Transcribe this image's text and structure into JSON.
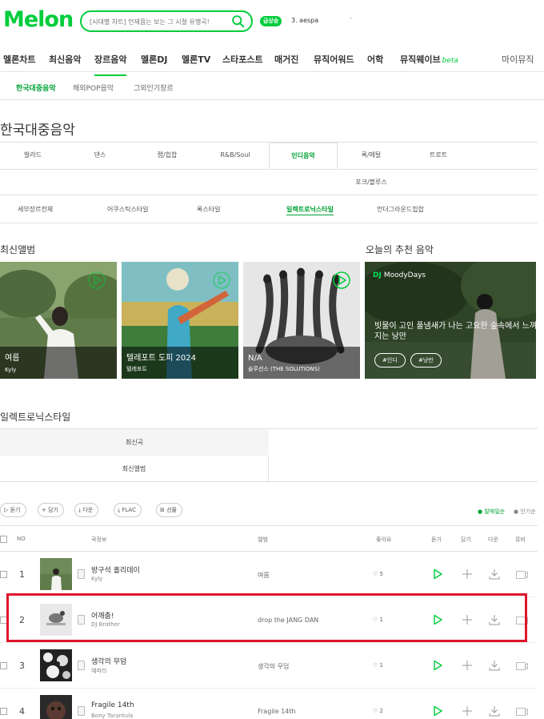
{
  "header": {
    "logo": "Melon",
    "search_placeholder": "[시대별 차트] 언제쯤는 보는 그 시절 유행곡!",
    "rank_badge": "급상승",
    "rank_text": "3.  aespa",
    "rank_dash": "-"
  },
  "gnb": {
    "items": [
      "멜론차트",
      "최신음악",
      "장르음악",
      "멜론DJ",
      "멜론TV",
      "스타포스트",
      "매거진",
      "뮤직어워드",
      "어학",
      "뮤직웨이브"
    ],
    "beta": "beta",
    "mymusic": "마이뮤직"
  },
  "lnb": {
    "items": [
      "한국대중음악",
      "해외POP음악",
      "그외인기장르"
    ]
  },
  "page_title": "한국대중음악",
  "genres": {
    "row1": [
      "발라드",
      "댄스",
      "랩/힙합",
      "R&B/Soul",
      "인디음악",
      "록/메탈",
      "트로트"
    ],
    "row2": [
      "포크/블루스"
    ]
  },
  "subgenres": [
    "세부장르전체",
    "어쿠스틱스타일",
    "록스타일",
    "일렉트로닉스타일",
    "언더그라운드힙합"
  ],
  "latest": {
    "title": "최신앨범",
    "albums": [
      {
        "title": "여름",
        "artist": "Kyly"
      },
      {
        "title": "텔레포트 도피 2024",
        "artist": "텔레포트"
      },
      {
        "title": "N/A",
        "artist": "솔루션스 (THE SOLUTIONS)"
      }
    ]
  },
  "recommend": {
    "title": "오늘의 추천 음악",
    "dj_label": "DJ",
    "dj_name": "MoodyDays",
    "dj_title": "빗물이 고인 풀냄새가 나는 고요한 숲속에서 느껴지는 낭만",
    "tags": [
      "#인디",
      "#낭만"
    ]
  },
  "electronic": {
    "title": "일렉트로닉스타일",
    "tab_songs": "최신곡",
    "tab_albums": "최신앨범"
  },
  "toolbar": {
    "buttons": [
      "듣기",
      "담기",
      "다운",
      "FLAC",
      "선물"
    ],
    "sort_on": "● 발매일순",
    "sort_off": "● 인기순"
  },
  "table": {
    "headers": {
      "no": "NO",
      "song": "곡정보",
      "album": "앨범",
      "like": "좋아요",
      "listen": "듣기",
      "add": "담기",
      "down": "다운",
      "mv": "뮤비"
    },
    "rows": [
      {
        "no": "1",
        "title": "방구석 홀리데이",
        "artist": "Kyly",
        "album": "여름",
        "likes": "5"
      },
      {
        "no": "2",
        "title": "어깨춤!",
        "artist": "DJ Brother",
        "album": "drop the JANG DAN",
        "likes": "1"
      },
      {
        "no": "3",
        "title": "생각의 무덤",
        "artist": "혜파리",
        "album": "생각의 무덤",
        "likes": "1"
      },
      {
        "no": "4",
        "title": "Fragile 14th",
        "artist": "Bony Tarantula",
        "album": "Fragile 14th",
        "likes": "2"
      }
    ]
  },
  "colors": {
    "brand": "#00cd3c",
    "highlight": "#e0152a"
  }
}
